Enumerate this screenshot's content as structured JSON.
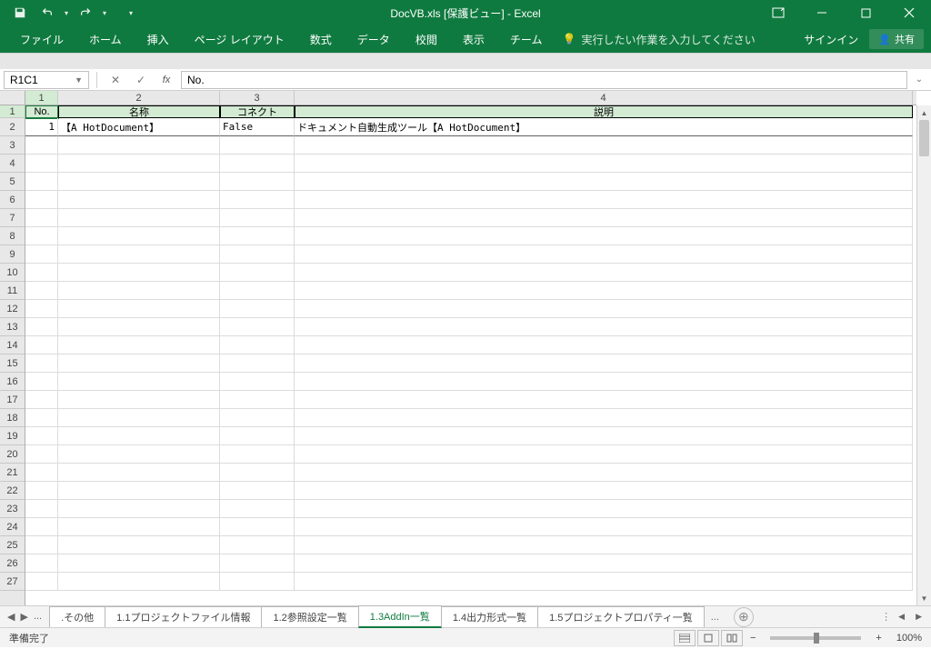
{
  "title": "DocVB.xls [保護ビュー] - Excel",
  "ribbon": {
    "tabs": [
      "ファイル",
      "ホーム",
      "挿入",
      "ページ レイアウト",
      "数式",
      "データ",
      "校閲",
      "表示",
      "チーム"
    ],
    "tell_me": "実行したい作業を入力してください",
    "signin": "サインイン",
    "share": "共有"
  },
  "name_box": "R1C1",
  "formula": "No.",
  "columns": {
    "c1": "1",
    "c2": "2",
    "c3": "3",
    "c4": "4"
  },
  "headers": {
    "no": "No.",
    "name": "名称",
    "connect": "コネクト",
    "desc": "説明"
  },
  "data": {
    "r2": {
      "no": "1",
      "name": "【A HotDocument】",
      "connect": "False",
      "desc": "ドキュメント自動生成ツール【A HotDocument】"
    }
  },
  "row_labels": [
    "1",
    "2",
    "3",
    "4",
    "5",
    "6",
    "7",
    "8",
    "9",
    "10",
    "11",
    "12",
    "13",
    "14",
    "15",
    "16",
    "17",
    "18",
    "19",
    "20",
    "21",
    "22",
    "23",
    "24",
    "25",
    "26",
    "27"
  ],
  "sheet_tabs": {
    "items": [
      ".その他",
      "1.1プロジェクトファイル情報",
      "1.2参照設定一覧",
      "1.3AddIn一覧",
      "1.4出力形式一覧",
      "1.5プロジェクトプロパティ一覧"
    ],
    "active_index": 3,
    "ellipsis": "..."
  },
  "status": {
    "ready": "準備完了",
    "zoom": "100%"
  }
}
